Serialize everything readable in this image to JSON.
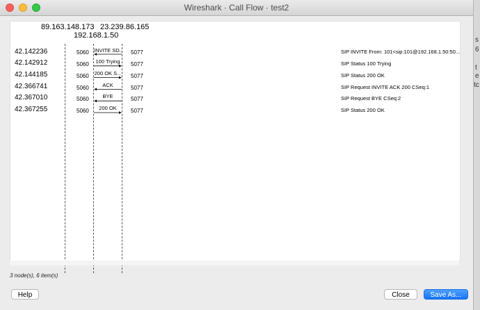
{
  "window": {
    "title": "Wireshark · Call Flow · test2"
  },
  "nodes": [
    {
      "address": "89.163.148.173"
    },
    {
      "address": "192.168.1.50"
    },
    {
      "address": "23.239.86.165"
    }
  ],
  "flows": [
    {
      "time": "42.142236",
      "src_port": "5060",
      "dst_port": "5077",
      "label": "INVITE SD...",
      "direction": "left",
      "comment": "SIP INVITE From: 101<sip:101@192.168.1.50:50..."
    },
    {
      "time": "42.142912",
      "src_port": "5060",
      "dst_port": "5077",
      "label": "100 Trying",
      "direction": "right",
      "comment": "SIP Status 100 Trying"
    },
    {
      "time": "42.144185",
      "src_port": "5060",
      "dst_port": "5077",
      "label": "200 OK S...",
      "direction": "right",
      "comment": "SIP Status 200 OK"
    },
    {
      "time": "42.366741",
      "src_port": "5060",
      "dst_port": "5077",
      "label": "ACK",
      "direction": "left",
      "comment": "SIP Request INVITE ACK 200 CSeq:1"
    },
    {
      "time": "42.367010",
      "src_port": "5060",
      "dst_port": "5077",
      "label": "BYE",
      "direction": "left",
      "comment": "SIP Request BYE CSeq:2"
    },
    {
      "time": "42.367255",
      "src_port": "5060",
      "dst_port": "5077",
      "label": "200 OK",
      "direction": "right",
      "comment": "SIP Status 200 OK"
    }
  ],
  "status": "3 node(s), 6 item(s)",
  "buttons": {
    "help": "Help",
    "close": "Close",
    "save": "Save As..."
  },
  "backdrop": {
    "fragments": [
      "s",
      "6",
      "t",
      "e",
      "tc"
    ]
  }
}
